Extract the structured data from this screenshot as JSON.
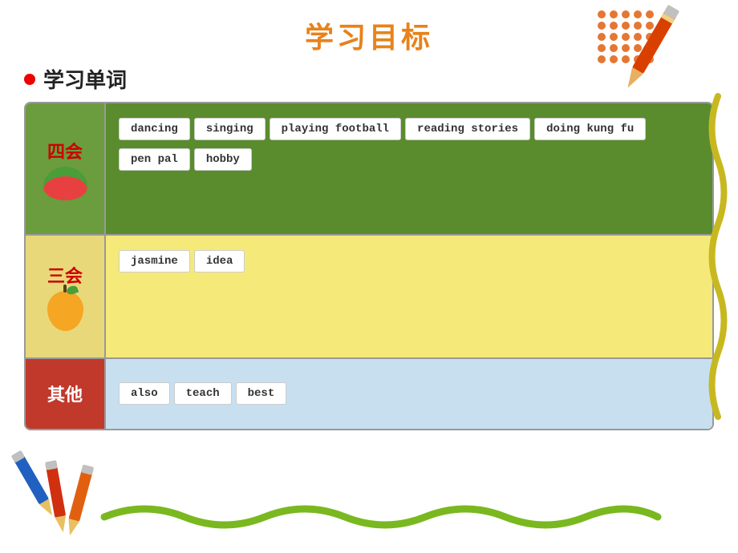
{
  "title": "学习目标",
  "bullet": {
    "label": "学习单词"
  },
  "sections": {
    "sihui": {
      "label": "四会",
      "words_row1": [
        "dancing",
        "singing",
        "playing football",
        "reading stories",
        "doing kung fu"
      ],
      "words_row2": [
        "pen pal",
        "hobby"
      ]
    },
    "sanhui": {
      "label": "三会",
      "words_row1": [
        "jasmine",
        "idea"
      ]
    },
    "qita": {
      "label": "其他",
      "words_row1": [
        "also",
        "teach",
        "best"
      ]
    }
  },
  "decorations": {
    "polka_dot_rows": 5,
    "polka_dot_cols": 5
  }
}
